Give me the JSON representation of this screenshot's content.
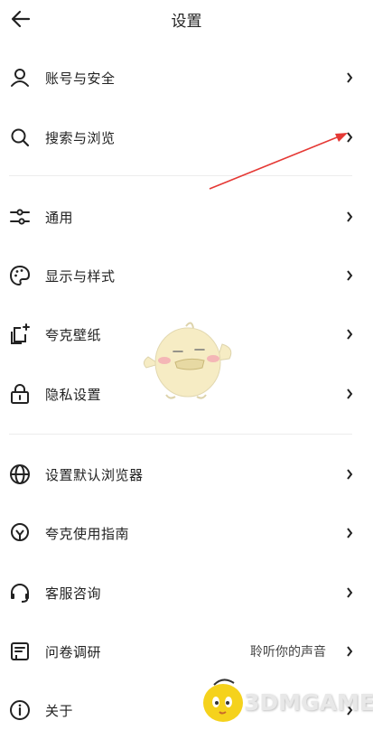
{
  "header": {
    "title": "设置"
  },
  "sections": [
    [
      {
        "id": "account",
        "label": "账号与安全",
        "icon": "user-icon"
      },
      {
        "id": "search",
        "label": "搜索与浏览",
        "icon": "search-icon"
      }
    ],
    [
      {
        "id": "general",
        "label": "通用",
        "icon": "sliders-icon"
      },
      {
        "id": "display",
        "label": "显示与样式",
        "icon": "palette-icon"
      },
      {
        "id": "wallpaper",
        "label": "夸克壁纸",
        "icon": "wallpaper-icon"
      },
      {
        "id": "privacy",
        "label": "隐私设置",
        "icon": "lock-icon"
      }
    ],
    [
      {
        "id": "default-browser",
        "label": "设置默认浏览器",
        "icon": "globe-icon"
      },
      {
        "id": "guide",
        "label": "夸克使用指南",
        "icon": "bulb-icon"
      },
      {
        "id": "support",
        "label": "客服咨询",
        "icon": "headset-icon"
      },
      {
        "id": "survey",
        "label": "问卷调研",
        "icon": "survey-icon",
        "right_text": "聆听你的声音"
      },
      {
        "id": "about",
        "label": "关于",
        "icon": "info-icon"
      }
    ]
  ],
  "watermark": {
    "text": "3DMGAME"
  },
  "colors": {
    "annotation_arrow": "#e53935",
    "mascot_body": "#f6ecc4",
    "watermark_badge": "#f5d21c"
  }
}
